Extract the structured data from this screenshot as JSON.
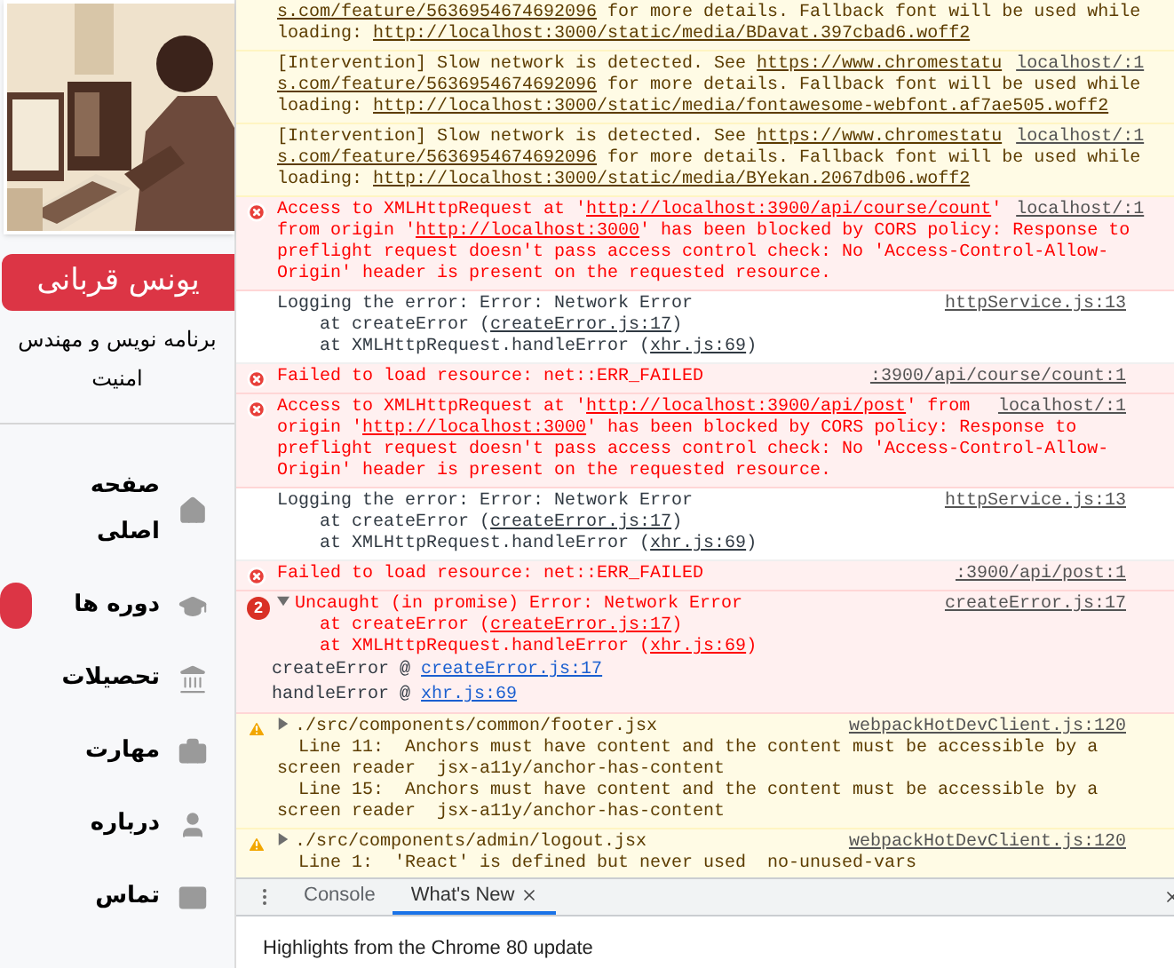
{
  "sidebar": {
    "profile": {
      "name": "یونس قربانی",
      "title": "برنامه نویس و مهندس امنیت"
    },
    "nav": [
      {
        "label": "صفحه اصلی",
        "badge": false
      },
      {
        "label": "دوره ها",
        "badge": true
      },
      {
        "label": "تحصیلات",
        "badge": false
      },
      {
        "label": "مهارت",
        "badge": false
      },
      {
        "label": "درباره",
        "badge": false
      },
      {
        "label": "تماس",
        "badge": false
      }
    ]
  },
  "console": {
    "messages": [
      {
        "kind": "intervention",
        "lines": [
          [
            {
              "text": "s.com/feature/5636954674692096",
              "link": true
            },
            {
              "text": " for more details. Fallback font will be used while",
              "link": false
            }
          ],
          [
            {
              "text": "loading: ",
              "link": false
            },
            {
              "text": "http://localhost:3000/static/media/BDavat.397cbad6.woff2",
              "link": true
            }
          ]
        ]
      },
      {
        "kind": "intervention",
        "source": "localhost/:1",
        "lines": [
          [
            {
              "text": "[Intervention] Slow network is detected. See ",
              "link": false
            },
            {
              "text": "https://www.chromestatu",
              "link": true
            }
          ],
          [
            {
              "text": "s.com/feature/5636954674692096",
              "link": true
            },
            {
              "text": " for more details. Fallback font will be used while",
              "link": false
            }
          ],
          [
            {
              "text": "loading: ",
              "link": false
            },
            {
              "text": "http://localhost:3000/static/media/fontawesome-webfont.af7ae505.woff2",
              "link": true
            }
          ]
        ]
      },
      {
        "kind": "intervention",
        "source": "localhost/:1",
        "lines": [
          [
            {
              "text": "[Intervention] Slow network is detected. See ",
              "link": false
            },
            {
              "text": "https://www.chromestatu",
              "link": true
            }
          ],
          [
            {
              "text": "s.com/feature/5636954674692096",
              "link": true
            },
            {
              "text": " for more details. Fallback font will be used while",
              "link": false
            }
          ],
          [
            {
              "text": "loading: ",
              "link": false
            },
            {
              "text": "http://localhost:3000/static/media/BYekan.2067db06.woff2",
              "link": true
            }
          ]
        ]
      },
      {
        "kind": "error",
        "source": "localhost/:1",
        "lines": [
          [
            {
              "text": "Access to XMLHttpRequest at '",
              "link": false
            },
            {
              "text": "http://localhost:3900/api/course/count",
              "link": true
            },
            {
              "text": "'",
              "link": false
            }
          ],
          [
            {
              "text": "from origin '",
              "link": false
            },
            {
              "text": "http://localhost:3000",
              "link": true
            },
            {
              "text": "' has been blocked by CORS policy: Response to",
              "link": false
            }
          ],
          [
            {
              "text": "preflight request doesn't pass access control check: No 'Access-Control-Allow-",
              "link": false
            }
          ],
          [
            {
              "text": "Origin' header is present on the requested resource.",
              "link": false
            }
          ]
        ]
      },
      {
        "kind": "log",
        "source": "httpService.js:13",
        "lines": [
          [
            {
              "text": "Logging the error: Error: Network Error",
              "link": false
            }
          ],
          [
            {
              "text": "    at createError (",
              "link": false
            },
            {
              "text": "createError.js:17",
              "link": true
            },
            {
              "text": ")",
              "link": false
            }
          ],
          [
            {
              "text": "    at XMLHttpRequest.handleError (",
              "link": false
            },
            {
              "text": "xhr.js:69",
              "link": true
            },
            {
              "text": ")",
              "link": false
            }
          ]
        ]
      },
      {
        "kind": "error",
        "source": ":3900/api/course/count:1",
        "lines": [
          [
            {
              "text": "Failed to load resource: net::ERR_FAILED",
              "link": false
            }
          ]
        ]
      },
      {
        "kind": "error",
        "source": "localhost/:1",
        "lines": [
          [
            {
              "text": "Access to XMLHttpRequest at '",
              "link": false
            },
            {
              "text": "http://localhost:3900/api/post",
              "link": true
            },
            {
              "text": "' from",
              "link": false
            }
          ],
          [
            {
              "text": "origin '",
              "link": false
            },
            {
              "text": "http://localhost:3000",
              "link": true
            },
            {
              "text": "' has been blocked by CORS policy: Response to",
              "link": false
            }
          ],
          [
            {
              "text": "preflight request doesn't pass access control check: No 'Access-Control-Allow-",
              "link": false
            }
          ],
          [
            {
              "text": "Origin' header is present on the requested resource.",
              "link": false
            }
          ]
        ]
      },
      {
        "kind": "log",
        "source": "httpService.js:13",
        "lines": [
          [
            {
              "text": "Logging the error: Error: Network Error",
              "link": false
            }
          ],
          [
            {
              "text": "    at createError (",
              "link": false
            },
            {
              "text": "createError.js:17",
              "link": true
            },
            {
              "text": ")",
              "link": false
            }
          ],
          [
            {
              "text": "    at XMLHttpRequest.handleError (",
              "link": false
            },
            {
              "text": "xhr.js:69",
              "link": true
            },
            {
              "text": ")",
              "link": false
            }
          ]
        ]
      },
      {
        "kind": "error",
        "source": ":3900/api/post:1",
        "lines": [
          [
            {
              "text": "Failed to load resource: net::ERR_FAILED",
              "link": false
            }
          ]
        ]
      },
      {
        "kind": "error",
        "count": "2",
        "expanded": true,
        "source": "createError.js:17",
        "lines": [
          [
            {
              "text": "Uncaught (in promise) Error: Network Error",
              "link": false
            }
          ],
          [
            {
              "text": "    at createError (",
              "link": false
            },
            {
              "text": "createError.js:17",
              "link": true
            },
            {
              "text": ")",
              "link": false
            }
          ],
          [
            {
              "text": "    at XMLHttpRequest.handleError (",
              "link": false
            },
            {
              "text": "xhr.js:69",
              "link": true
            },
            {
              "text": ")",
              "link": false
            }
          ]
        ],
        "call_stack": [
          {
            "text": "createError @",
            "link": "createError.js:17"
          },
          {
            "text": "handleError @",
            "link": "xhr.js:69"
          }
        ]
      },
      {
        "kind": "warning",
        "expanded": false,
        "source": "webpackHotDevClient.js:120",
        "lines": [
          [
            {
              "text": "./src/components/common/footer.jsx",
              "link": false
            }
          ],
          [
            {
              "text": "  Line 11:  Anchors must have content and the content must be accessible by a",
              "link": false
            }
          ],
          [
            {
              "text": "screen reader  jsx-a11y/anchor-has-content",
              "link": false
            }
          ],
          [
            {
              "text": "  Line 15:  Anchors must have content and the content must be accessible by a",
              "link": false
            }
          ],
          [
            {
              "text": "screen reader  jsx-a11y/anchor-has-content",
              "link": false
            }
          ]
        ]
      },
      {
        "kind": "warning",
        "expanded": false,
        "source": "webpackHotDevClient.js:120",
        "lines": [
          [
            {
              "text": "./src/components/admin/logout.jsx",
              "link": false
            }
          ],
          [
            {
              "text": "  Line 1:  'React' is defined but never used  no-unused-vars",
              "link": false
            }
          ]
        ]
      }
    ]
  },
  "drawer": {
    "tabs": [
      {
        "label": "Console",
        "selected": false,
        "closable": false
      },
      {
        "label": "What's New",
        "selected": true,
        "closable": true
      }
    ],
    "content": "Highlights from the Chrome 80 update"
  }
}
